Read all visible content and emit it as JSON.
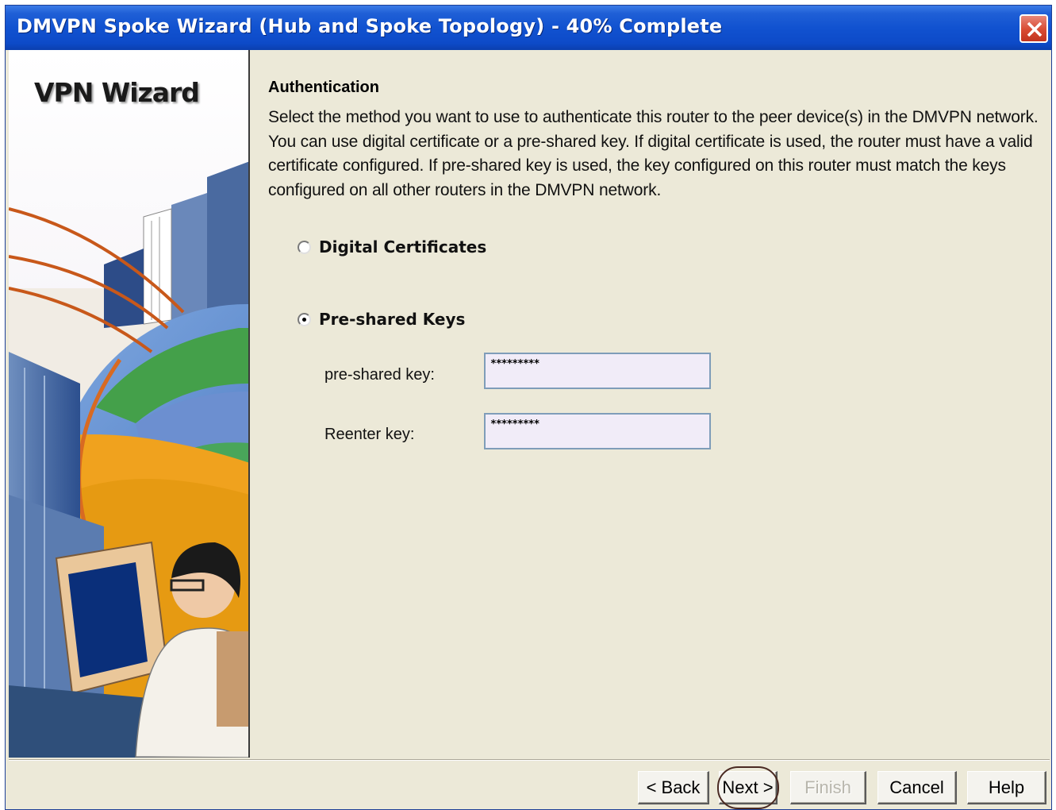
{
  "window": {
    "title": "DMVPN Spoke Wizard (Hub and Spoke Topology) - 40% Complete",
    "progress_percent": 40
  },
  "side_panel": {
    "title": "VPN Wizard"
  },
  "content": {
    "heading": "Authentication",
    "description": "Select the method you want to use to authenticate this router to the peer device(s) in the DMVPN network. You can use digital certificate or a pre-shared key. If digital certificate is used, the router must have a valid certificate configured. If pre-shared key is used, the key configured on this router must match the keys configured on all other routers in the DMVPN network.",
    "options": [
      {
        "label": "Digital Certificates",
        "selected": false
      },
      {
        "label": "Pre-shared Keys",
        "selected": true
      }
    ],
    "fields": {
      "psk_label": "pre-shared key:",
      "psk_value": "*********",
      "reenter_label": "Reenter key:",
      "reenter_value": "*********"
    }
  },
  "buttons": {
    "back": "< Back",
    "next": "Next >",
    "finish": "Finish",
    "cancel": "Cancel",
    "help": "Help"
  },
  "icons": {
    "close": "close-icon",
    "radio": "radio-icon"
  },
  "colors": {
    "titlebar": "#0d4ac8",
    "close_button": "#d84a32",
    "dialog_background": "#ece9d8",
    "input_background": "#f1ecf8"
  }
}
